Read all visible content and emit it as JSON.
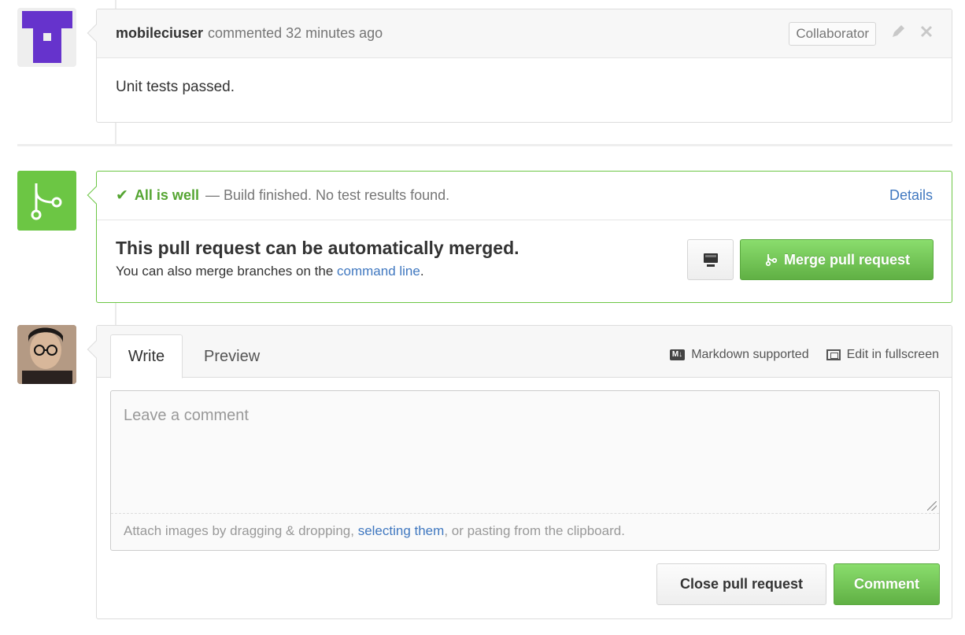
{
  "comment": {
    "author": "mobileciuser",
    "meta": "commented 32 minutes ago",
    "badge": "Collaborator",
    "body": "Unit tests passed."
  },
  "merge": {
    "status_check": "✔",
    "status_ok": "All is well",
    "status_text": "— Build finished. No test results found.",
    "details_link": "Details",
    "title": "This pull request can be automatically merged.",
    "subtitle_prefix": "You can also merge branches on the ",
    "subtitle_link": "command line",
    "subtitle_suffix": ".",
    "merge_button": "Merge pull request"
  },
  "composer": {
    "tabs": [
      "Write",
      "Preview"
    ],
    "markdown_label": "Markdown supported",
    "markdown_icon_text": "M↓",
    "fullscreen_label": "Edit in fullscreen",
    "placeholder": "Leave a comment",
    "attach_prefix": "Attach images by dragging & dropping, ",
    "attach_link": "selecting them",
    "attach_suffix": ", or pasting from the clipboard.",
    "close_button": "Close pull request",
    "comment_button": "Comment"
  },
  "colors": {
    "success_green": "#6cc644",
    "link_blue": "#4078c0",
    "bot_avatar_purple": "#6633cc"
  },
  "icons": {
    "edit": "pencil-icon",
    "delete": "close-icon",
    "merge": "git-merge-icon",
    "desktop": "desktop-icon",
    "markdown": "markdown-icon",
    "fullscreen": "fullscreen-icon"
  }
}
